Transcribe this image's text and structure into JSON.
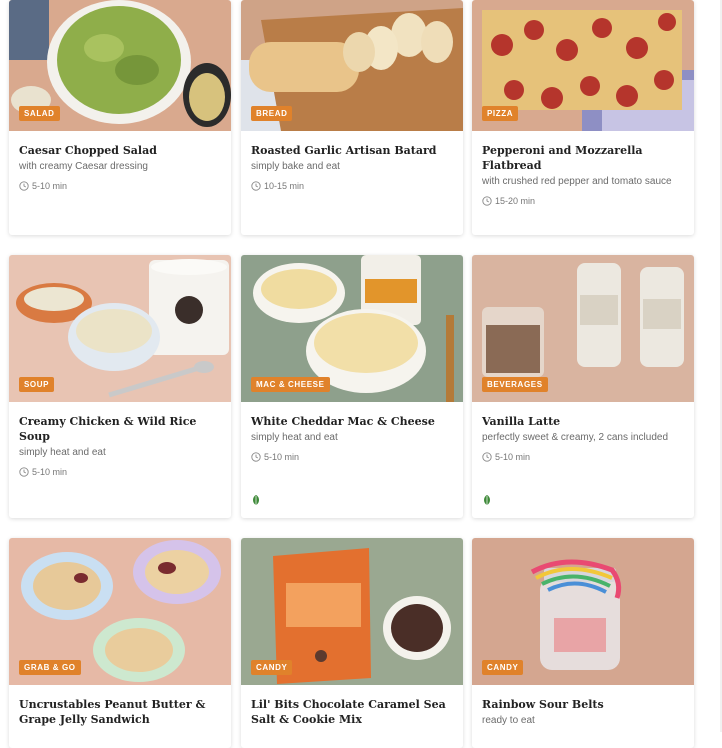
{
  "cards": [
    {
      "category": "SALAD",
      "title": "Caesar Chopped Salad",
      "subtitle": "with creamy Caesar dressing",
      "time": "5-10 min",
      "veg_icon": false,
      "image_icon": "salad-image"
    },
    {
      "category": "BREAD",
      "title": "Roasted Garlic Artisan Batard",
      "subtitle": "simply bake and eat",
      "time": "10-15 min",
      "veg_icon": false,
      "image_icon": "bread-image"
    },
    {
      "category": "PIZZA",
      "title": "Pepperoni and Mozzarella Flatbread",
      "subtitle": "with crushed red pepper and tomato sauce",
      "time": "15-20 min",
      "veg_icon": false,
      "image_icon": "flatbread-image"
    },
    {
      "category": "SOUP",
      "title": "Creamy Chicken & Wild Rice Soup",
      "subtitle": "simply heat and eat",
      "time": "5-10 min",
      "veg_icon": false,
      "image_icon": "soup-image"
    },
    {
      "category": "MAC & CHEESE",
      "title": "White Cheddar Mac & Cheese",
      "subtitle": "simply heat and eat",
      "time": "5-10 min",
      "veg_icon": true,
      "image_icon": "mac-cheese-image"
    },
    {
      "category": "BEVERAGES",
      "title": "Vanilla Latte",
      "subtitle": "perfectly sweet & creamy, 2 cans included",
      "time": "5-10 min",
      "veg_icon": true,
      "image_icon": "latte-image"
    },
    {
      "category": "GRAB & GO",
      "title": "Uncrustables Peanut Butter & Grape Jelly Sandwich",
      "subtitle": "",
      "time": "",
      "veg_icon": false,
      "image_icon": "sandwich-image"
    },
    {
      "category": "CANDY",
      "title": "Lil' Bits Chocolate Caramel Sea Salt & Cookie Mix",
      "subtitle": "",
      "time": "",
      "veg_icon": false,
      "image_icon": "chocolate-image"
    },
    {
      "category": "CANDY",
      "title": "Rainbow Sour Belts",
      "subtitle": "ready to eat",
      "time": "",
      "veg_icon": false,
      "image_icon": "candy-jar-image"
    }
  ],
  "colors": {
    "badge": "#e0822b",
    "veg_icon": "#3f8a3a"
  }
}
